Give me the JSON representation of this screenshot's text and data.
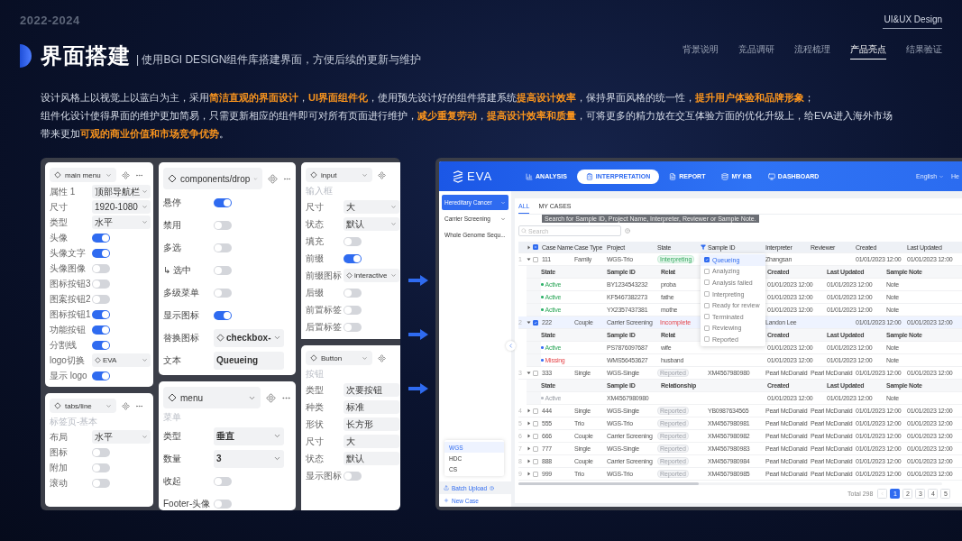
{
  "header": {
    "year": "2022-2024",
    "brand": "UI&UX Design"
  },
  "title": "界面搭建",
  "subtitle": "| 使用BGI DESIGN组件库搭建界面，方便后续的更新与维护",
  "nav": [
    {
      "label": "背景说明",
      "selected": false
    },
    {
      "label": "竞品调研",
      "selected": false
    },
    {
      "label": "流程梳理",
      "selected": false
    },
    {
      "label": "产品亮点",
      "selected": true
    },
    {
      "label": "结果验证",
      "selected": false
    }
  ],
  "description": [
    "设计风格上以视觉上以蓝白为主，采用**简洁直观的界面设计**，**UI界面组件化**，使用预先设计好的组件搭建系统**提高设计效率**，保持界面风格的统一性，**提升用户体验和品牌形象**；",
    "组件化设计使得界面的维护更加简易，只需更新相应的组件即可对所有页面进行维护，**减少重复劳动**，**提高设计效率和质量**，可将更多的精力放在交互体验方面的优化升级上，给EVA进入海外市场带来更加**可观的商业价值和市场竞争优势**。"
  ],
  "panel_columns": [
    [
      {
        "title": "main menu",
        "rows": [
          {
            "kind": "select",
            "label": "属性 1",
            "value": "顶部导航栏"
          },
          {
            "kind": "select",
            "label": "尺寸",
            "value": "1920-1080"
          },
          {
            "kind": "select",
            "label": "类型",
            "value": "水平"
          },
          {
            "kind": "toggle",
            "label": "头像",
            "on": true
          },
          {
            "kind": "toggle",
            "label": "头像文字",
            "on": true
          },
          {
            "kind": "toggle",
            "label": "头像图像",
            "on": false
          },
          {
            "kind": "toggle",
            "label": "图标按钮3",
            "on": false
          },
          {
            "kind": "toggle",
            "label": "图案按钮2",
            "on": false
          },
          {
            "kind": "toggle",
            "label": "图标按钮1",
            "on": true
          },
          {
            "kind": "toggle",
            "label": "功能按钮",
            "on": true
          },
          {
            "kind": "toggle",
            "label": "分割线",
            "on": true
          },
          {
            "kind": "component",
            "label": "logo切换",
            "value": "EVA"
          },
          {
            "kind": "toggle",
            "label": "显示 logo",
            "on": true
          }
        ]
      },
      {
        "title": "tabs/line",
        "subtitle": "标签页-基本",
        "rows": [
          {
            "kind": "select",
            "label": "布局",
            "value": "水平"
          },
          {
            "kind": "toggle",
            "label": "图标",
            "on": false
          },
          {
            "kind": "toggle",
            "label": "附加",
            "on": false
          },
          {
            "kind": "toggle",
            "label": "滚动",
            "on": false
          }
        ]
      }
    ],
    [
      {
        "title": "components/drop",
        "rows": [
          {
            "kind": "toggle",
            "label": "悬停",
            "on": true
          },
          {
            "kind": "toggle",
            "label": "禁用",
            "on": false
          },
          {
            "kind": "toggle",
            "label": "多选",
            "on": false
          },
          {
            "kind": "toggle",
            "label": "↳ 选中",
            "on": false
          },
          {
            "kind": "toggle",
            "label": "多级菜单",
            "on": false
          },
          {
            "kind": "toggle",
            "label": "显示图标",
            "on": true
          },
          {
            "kind": "component",
            "label": "替换图标",
            "value": "checkbox-"
          },
          {
            "kind": "field",
            "label": "文本",
            "value": "Queueing"
          }
        ]
      },
      {
        "title": "menu",
        "subtitle": "菜单",
        "rows": [
          {
            "kind": "select",
            "label": "类型",
            "value": "垂直"
          },
          {
            "kind": "select",
            "label": "数量",
            "value": "3"
          },
          {
            "kind": "toggle",
            "label": "收起",
            "on": false
          },
          {
            "kind": "toggle",
            "label": "Footer-头像",
            "on": false
          }
        ]
      }
    ],
    [
      {
        "title": "input",
        "subtitle": "输入框",
        "rows": [
          {
            "kind": "select",
            "label": "尺寸",
            "value": "大"
          },
          {
            "kind": "select",
            "label": "状态",
            "value": "默认"
          },
          {
            "kind": "toggle",
            "label": "填充",
            "on": false
          },
          {
            "kind": "toggle",
            "label": "前缀",
            "on": true
          },
          {
            "kind": "component",
            "label": "前缀图标",
            "value": "interactive"
          },
          {
            "kind": "toggle",
            "label": "后缀",
            "on": false
          },
          {
            "kind": "toggle",
            "label": "前置标签",
            "on": false
          },
          {
            "kind": "toggle",
            "label": "后置标签",
            "on": false
          }
        ]
      },
      {
        "title": "Button",
        "subtitle": "按钮",
        "rows": [
          {
            "kind": "field",
            "label": "类型",
            "value": "次要按钮"
          },
          {
            "kind": "field",
            "label": "种类",
            "value": "标准"
          },
          {
            "kind": "field",
            "label": "形状",
            "value": "长方形"
          },
          {
            "kind": "field",
            "label": "尺寸",
            "value": "大"
          },
          {
            "kind": "field",
            "label": "状态",
            "value": "默认"
          },
          {
            "kind": "toggle",
            "label": "显示图标",
            "on": false
          }
        ]
      }
    ]
  ],
  "app": {
    "logo": "EVA",
    "nav": [
      {
        "label": "ANALYSIS",
        "selected": false
      },
      {
        "label": "INTERPRETATION",
        "selected": true
      },
      {
        "label": "REPORT",
        "selected": false
      },
      {
        "label": "MY KB",
        "selected": false
      },
      {
        "label": "DASHBOARD",
        "selected": false
      }
    ],
    "language": "English",
    "user": "He",
    "sidebar": [
      {
        "label": "Hereditary Cancer",
        "selected": true
      },
      {
        "label": "Carrier Screening",
        "selected": false
      },
      {
        "label": "Whole Genome Sequ...",
        "selected": false
      }
    ],
    "menu": [
      {
        "label": "WGS",
        "selected": true
      },
      {
        "label": "HDC",
        "selected": false
      },
      {
        "label": "CS",
        "selected": false
      }
    ],
    "batch_upload": "Batch Upload",
    "new_case": "New Case",
    "tabs": [
      {
        "label": "ALL",
        "selected": true
      },
      {
        "label": "MY CASES",
        "selected": false
      }
    ],
    "tooltip": "Search for Sample ID, Project Name, Interpreter, Reviewer or Sample Note.",
    "search": {
      "placeholder": "Search"
    },
    "table": {
      "header_checked": true,
      "columns": [
        "Case Name",
        "Case Type",
        "Project",
        "State",
        "Sample ID",
        "Interpreter",
        "Reviewer",
        "Created",
        "Last Updated"
      ],
      "rows": [
        {
          "index": "1",
          "expanded": true,
          "checked": false,
          "case_name": "111",
          "case_type": "Family",
          "project": "WGS-Trio",
          "state": "Interpreting",
          "kind": "success",
          "interpreter": "Zhangsan",
          "created": "01/01/2023 12:00",
          "last_updated": "01/01/2023 12:00",
          "sub_columns": [
            "State",
            "Sample ID",
            "Relat",
            "Created",
            "Last Updated",
            "Sample Note"
          ],
          "samples": [
            {
              "state": "Active",
              "kind": "success",
              "color": "#2fb36b",
              "sample_id": "BY1234543232",
              "relationship": "proba",
              "created": "01/01/2023 12:00",
              "last_updated": "01/01/2023 12:00",
              "note": "Note"
            },
            {
              "state": "Active",
              "kind": "success",
              "color": "#2fb36b",
              "sample_id": "KF5467382273",
              "relationship": "fathe",
              "created": "01/01/2023 12:00",
              "last_updated": "01/01/2023 12:00",
              "note": "Note"
            },
            {
              "state": "Active",
              "kind": "success",
              "color": "#2fb36b",
              "sample_id": "YX2357437381",
              "relationship": "mothe",
              "created": "01/01/2023 12:00",
              "last_updated": "01/01/2023 12:00",
              "note": "Note"
            }
          ]
        },
        {
          "index": "2",
          "expanded": true,
          "checked": true,
          "case_name": "222",
          "case_type": "Couple",
          "project": "Carrier Screening",
          "state": "Incomplete",
          "kind": "danger",
          "interpreter": "Landon Lee",
          "created": "01/01/2023 12:00",
          "last_updated": "01/01/2023 12:00",
          "sub_columns": [
            "State",
            "Sample ID",
            "Relat",
            "Created",
            "Last Updated",
            "Sample Note"
          ],
          "samples": [
            {
              "state": "Active",
              "kind": "success",
              "color": "#3b6ff5",
              "sample_id": "PS7876097687",
              "relationship": "wife",
              "created": "01/01/2023 12:00",
              "last_updated": "01/01/2023 12:00",
              "note": "Note"
            },
            {
              "state": "Missing",
              "kind": "danger",
              "color": "#3b6ff5",
              "sample_id": "WMS56453627",
              "relationship": "husband",
              "created": "01/01/2023 12:00",
              "last_updated": "01/01/2023 12:00",
              "note": "Note"
            }
          ]
        },
        {
          "index": "3",
          "expanded": true,
          "checked": false,
          "case_name": "333",
          "case_type": "Single",
          "project": "WGS-Single",
          "state": "Reported",
          "kind": "neutral",
          "sample_id": "XM4567980980",
          "interpreter": "Pearl McDonald",
          "reviewer": "Pearl McDonald",
          "created": "01/01/2023 12:00",
          "last_updated": "01/01/2023 12:00",
          "sub_columns": [
            "State",
            "Sample ID",
            "Relationship",
            "Created",
            "Last Updated",
            "Sample Note"
          ],
          "samples": [
            {
              "state": "Active",
              "kind": "neutral",
              "color": "#b8bcc4",
              "sample_id": "XM4567980980",
              "created": "01/01/2023 12:00",
              "last_updated": "01/01/2023 12:00",
              "note": "Note"
            }
          ]
        },
        {
          "index": "4",
          "expanded": false,
          "checked": false,
          "case_name": "444",
          "case_type": "Single",
          "project": "WGS-Single",
          "state": "Reported",
          "kind": "neutral",
          "sample_id": "YB0987634565",
          "interpreter": "Pearl McDonald",
          "reviewer": "Pearl McDonald",
          "created": "01/01/2023 12:00",
          "last_updated": "01/01/2023 12:00"
        },
        {
          "index": "5",
          "expanded": false,
          "checked": false,
          "case_name": "555",
          "case_type": "Trio",
          "project": "WGS-Trio",
          "state": "Reported",
          "kind": "neutral",
          "sample_id": "XM4567980981",
          "interpreter": "Pearl McDonald",
          "reviewer": "Pearl McDonald",
          "created": "01/01/2023 12:00",
          "last_updated": "01/01/2023 12:00"
        },
        {
          "index": "6",
          "expanded": false,
          "checked": false,
          "case_name": "666",
          "case_type": "Couple",
          "project": "Carrier Screening",
          "state": "Reported",
          "kind": "neutral",
          "sample_id": "XM4567980982",
          "interpreter": "Pearl McDonald",
          "reviewer": "Pearl McDonald",
          "created": "01/01/2023 12:00",
          "last_updated": "01/01/2023 12:00"
        },
        {
          "index": "7",
          "expanded": false,
          "checked": false,
          "case_name": "777",
          "case_type": "Single",
          "project": "WGS-Single",
          "state": "Reported",
          "kind": "neutral",
          "sample_id": "XM4567980983",
          "interpreter": "Pearl McDonald",
          "reviewer": "Pearl McDonald",
          "created": "01/01/2023 12:00",
          "last_updated": "01/01/2023 12:00"
        },
        {
          "index": "8",
          "expanded": false,
          "checked": false,
          "case_name": "888",
          "case_type": "Couple",
          "project": "Carrier Screening",
          "state": "Reported",
          "kind": "neutral",
          "sample_id": "XM4567980984",
          "interpreter": "Pearl McDonald",
          "reviewer": "Pearl McDonald",
          "created": "01/01/2023 12:00",
          "last_updated": "01/01/2023 12:00"
        },
        {
          "index": "9",
          "expanded": false,
          "checked": false,
          "case_name": "999",
          "case_type": "Trio",
          "project": "WGS-Trio",
          "state": "Reported",
          "kind": "neutral",
          "sample_id": "XM4567980985",
          "interpreter": "Pearl McDonald",
          "reviewer": "Pearl McDonald",
          "created": "01/01/2023 12:00",
          "last_updated": "01/01/2023 12:00"
        }
      ]
    },
    "filter_options": [
      {
        "label": "Queueing",
        "checked": true
      },
      {
        "label": "Analyzing",
        "checked": false
      },
      {
        "label": "Analysis failed",
        "checked": false
      },
      {
        "label": "Interpreting",
        "checked": false
      },
      {
        "label": "Ready for review",
        "checked": false
      },
      {
        "label": "Terminated",
        "checked": false
      },
      {
        "label": "Reviewing",
        "checked": false
      },
      {
        "label": "Reported",
        "checked": false
      }
    ],
    "pagination": {
      "total": "Total 298",
      "pages": [
        {
          "label": "1",
          "selected": true
        },
        {
          "label": "2",
          "selected": false
        },
        {
          "label": "3",
          "selected": false
        },
        {
          "label": "4",
          "selected": false
        },
        {
          "label": "5",
          "selected": false
        }
      ]
    }
  }
}
